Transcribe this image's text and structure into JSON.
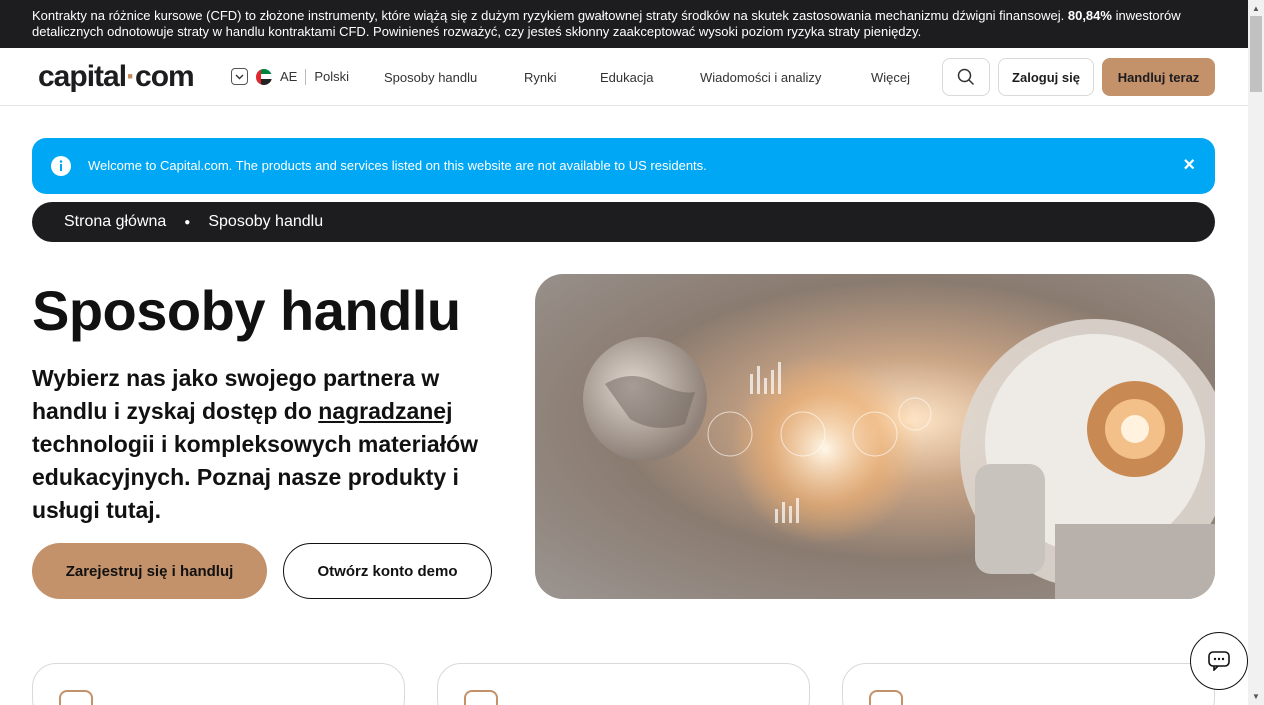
{
  "risk_warning": {
    "text": "Kontrakty na różnice kursowe (CFD) to złożone instrumenty, które wiążą się z dużym ryzykiem gwałtownej straty środków na skutek zastosowania mechanizmu dźwigni finansowej.",
    "percent": "80,84%",
    "text2": "inwestorów detalicznych odnotowuje straty w handlu kontraktami CFD. Powinieneś rozważyć, czy jesteś skłonny zaakceptować wysoki poziom ryzyka straty pieniędzy."
  },
  "header": {
    "logo_left": "capital",
    "logo_dot": "·",
    "logo_right": "com",
    "region": "AE",
    "language": "Polski",
    "nav": [
      "Sposoby handlu",
      "Rynki",
      "Edukacja",
      "Wiadomości i analizy",
      "Więcej"
    ],
    "login": "Zaloguj się",
    "trade": "Handluj teraz"
  },
  "notice": {
    "message": "Welcome to Capital.com. The products and services listed on this website are not available to US residents.",
    "close": "×"
  },
  "breadcrumb": {
    "home": "Strona główna",
    "current": "Sposoby handlu"
  },
  "hero": {
    "title": "Sposoby handlu",
    "lead_1": "Wybierz nas jako swojego partnera w handlu i zyskaj dostęp do ",
    "lead_link": "nagradzanej",
    "lead_2": " technologii i kompleksowych materiałów edukacyjnych. Poznaj nasze produkty i usługi tutaj.",
    "cta_primary": "Zarejestruj się i handluj",
    "cta_secondary": "Otwórz konto demo"
  },
  "colors": {
    "accent": "#c3916a",
    "notice_bg": "#00a7f5",
    "dark": "#1d1c1f"
  }
}
